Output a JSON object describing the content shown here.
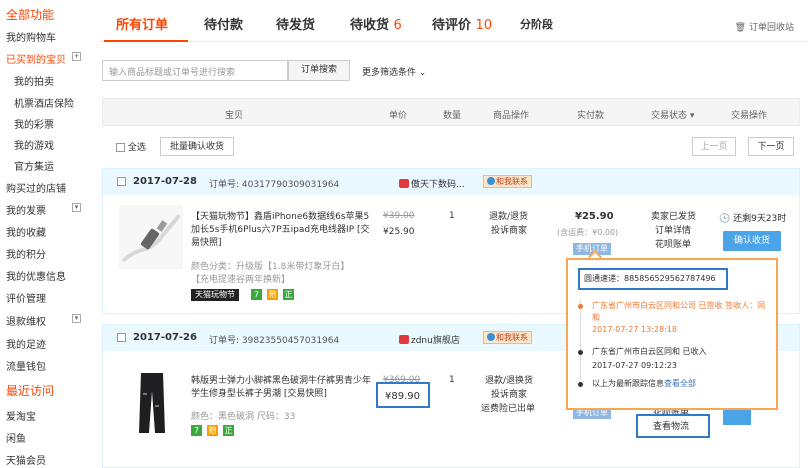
{
  "sidebar": {
    "title_all": "全部功能",
    "items": [
      "我的购物车",
      "已买到的宝贝",
      "我的拍卖",
      "机票酒店保险",
      "我的彩票",
      "我的游戏",
      "官方集运",
      "购买过的店铺",
      "我的发票",
      "我的收藏",
      "我的积分",
      "我的优惠信息",
      "评价管理",
      "退款维权",
      "我的足迹",
      "流量钱包"
    ],
    "recent_title": "最近访问",
    "recent": [
      "爱淘宝",
      "闲鱼",
      "天猫会员"
    ]
  },
  "tabs": [
    {
      "label": "所有订单",
      "count": ""
    },
    {
      "label": "待付款",
      "count": ""
    },
    {
      "label": "待发货",
      "count": ""
    },
    {
      "label": "待收货",
      "count": "6"
    },
    {
      "label": "待评价",
      "count": "10"
    },
    {
      "label": "分阶段",
      "count": ""
    }
  ],
  "recycle": "订单回收站",
  "search": {
    "placeholder": "输入商品标题或订单号进行搜索",
    "button": "订单搜索",
    "more": "更多筛选条件"
  },
  "columns": [
    "宝贝",
    "单价",
    "数量",
    "商品操作",
    "实付款",
    "交易状态",
    "交易操作"
  ],
  "bulk": {
    "select_all": "全选",
    "batch_confirm": "批量确认收货",
    "prev": "上一页",
    "next": "下一页"
  },
  "orders": [
    {
      "date": "2017-07-28",
      "order_no": "订单号: 40317790309031964",
      "shop": "傲天下数码...",
      "chat": "和我联系",
      "title": "【天猫玩物节】鑫盾iPhone6数据线6s苹果5加长5s手机6Plus六7P五ipad充电线器IP [交易快照]",
      "attr1": "颜色分类：升级版【1.8米带灯象牙白】",
      "attr2": "【充电提速谷两年换新】",
      "tmall_badge": "天猫玩物节",
      "price_old": "¥39.00",
      "price": "¥25.90",
      "qty": "1",
      "ops": [
        "退款/退货",
        "投诉商家"
      ],
      "pay": "¥25.90",
      "pay_sub": "(含运费：¥0.00)",
      "mobile": "手机订单",
      "status": [
        "卖家已发货",
        "订单详情",
        "花呗账单"
      ],
      "remain": "还剩9天23时",
      "confirm": "确认收货"
    },
    {
      "date": "2017-07-26",
      "order_no": "订单号: 39823550457031964",
      "shop": "zdnu旗舰店",
      "chat": "和我联系",
      "title": "韩版男士弹力小脚裤黑色破洞牛仔裤男青少年学生修身型长裤子男潮 [交易快照]",
      "attr1": "颜色：黑色破洞  尺码：33",
      "price_old": "¥369.00",
      "price": "¥89.90",
      "qty": "1",
      "ops": [
        "退款/退换货",
        "投诉商家",
        "运费险已出单"
      ],
      "mobile": "手机订单",
      "status_extra": "花呗账单",
      "logistics": "查看物流"
    }
  ],
  "popover": {
    "carrier": "圆通速递：885856529562787496",
    "events": [
      {
        "text": "广东省广州市白云区同和公司 已签收 签收人：同和",
        "time": "2017-07-27 13:28:18",
        "color": "#f0782f"
      },
      {
        "text": "广东省广州市白云区同和 已收入",
        "time": "2017-07-27 09:12:23",
        "color": "#333333"
      }
    ],
    "more_prefix": "以上为最新跟踪信息",
    "more_link": "查看全部"
  }
}
